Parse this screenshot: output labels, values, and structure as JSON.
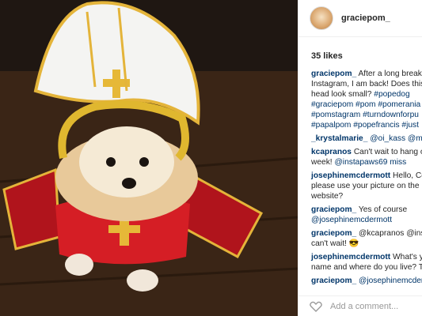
{
  "post": {
    "username": "graciepom_",
    "likes": "35 likes",
    "comments": [
      {
        "user": "graciepom_",
        "text": "After a long break Instagram, I am back! Does this my head look small?",
        "tags": "#popedog #graciepom #pom #pomerania #pomstagram #turndownforpu #papalpom #popefrancis #just"
      },
      {
        "user": "_krystalmarie_",
        "text": "@oi_kass @ma",
        "tags": ""
      },
      {
        "user": "kcapranos",
        "text": "Can't wait to hang o for a week!",
        "tags": "@instapaws69 miss"
      },
      {
        "user": "josephinemcdermott",
        "text": "Hello, Co please use your picture on the website?",
        "tags": ""
      },
      {
        "user": "graciepom_",
        "text": "Yes of course",
        "tags": "@josephinemcdermott"
      },
      {
        "user": "graciepom_",
        "text": "@kcapranos @inst can't wait! 😎",
        "tags": ""
      },
      {
        "user": "josephinemcdermott",
        "text": "What's yo name and where do you live? T",
        "tags": ""
      },
      {
        "user": "graciepom_",
        "text": "@josephinemcder",
        "tags": ""
      }
    ],
    "add_comment_placeholder": "Add a comment..."
  }
}
